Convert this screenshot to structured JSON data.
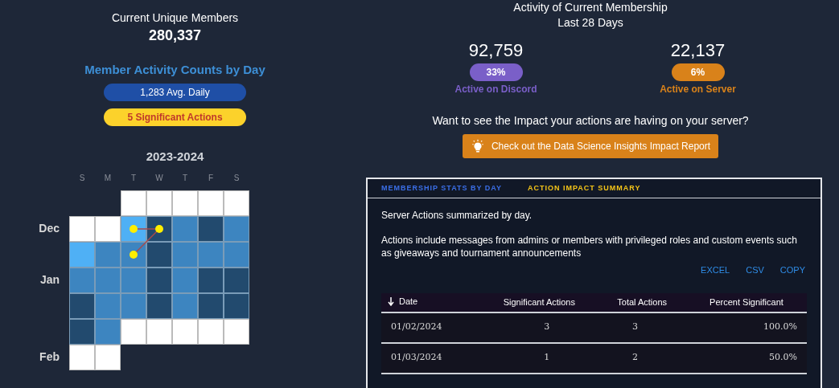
{
  "members": {
    "title": "Current Unique Members",
    "value": "280,337"
  },
  "activity_counts": {
    "title": "Member Activity Counts by Day",
    "badges": [
      {
        "text": "1,283 Avg. Daily",
        "kind": "info"
      },
      {
        "text": "5 Significant Actions",
        "kind": "warning"
      }
    ]
  },
  "calendar": {
    "title": "2023-2024",
    "weekdays": [
      "S",
      "M",
      "T",
      "W",
      "T",
      "F",
      "S"
    ],
    "weeks": [
      {
        "cells": [
          {
            "kind": "empty"
          },
          {
            "kind": "empty"
          },
          {
            "kind": "blank"
          },
          {
            "kind": "blank"
          },
          {
            "kind": "blank"
          },
          {
            "kind": "blank"
          },
          {
            "kind": "blank"
          }
        ]
      },
      {
        "month": "Dec",
        "cells": [
          {
            "kind": "blank"
          },
          {
            "kind": "blank"
          },
          {
            "kind": "low",
            "significant": true
          },
          {
            "kind": "high",
            "significant": true
          },
          {
            "kind": "mid"
          },
          {
            "kind": "high"
          },
          {
            "kind": "mid"
          }
        ]
      },
      {
        "cells": [
          {
            "kind": "low"
          },
          {
            "kind": "mid"
          },
          {
            "kind": "mid",
            "significant": true
          },
          {
            "kind": "high"
          },
          {
            "kind": "mid"
          },
          {
            "kind": "mid"
          },
          {
            "kind": "mid"
          }
        ]
      },
      {
        "month": "Jan",
        "cells": [
          {
            "kind": "mid"
          },
          {
            "kind": "mid"
          },
          {
            "kind": "mid"
          },
          {
            "kind": "high"
          },
          {
            "kind": "mid"
          },
          {
            "kind": "high"
          },
          {
            "kind": "high"
          }
        ]
      },
      {
        "cells": [
          {
            "kind": "high"
          },
          {
            "kind": "mid"
          },
          {
            "kind": "mid"
          },
          {
            "kind": "high"
          },
          {
            "kind": "mid"
          },
          {
            "kind": "high"
          },
          {
            "kind": "high"
          }
        ]
      },
      {
        "cells": [
          {
            "kind": "high"
          },
          {
            "kind": "mid"
          },
          {
            "kind": "blank"
          },
          {
            "kind": "blank"
          },
          {
            "kind": "blank"
          },
          {
            "kind": "blank"
          },
          {
            "kind": "blank"
          }
        ]
      },
      {
        "month": "Feb",
        "cells": [
          {
            "kind": "blank"
          },
          {
            "kind": "blank"
          },
          {
            "kind": "empty"
          },
          {
            "kind": "empty"
          },
          {
            "kind": "empty"
          },
          {
            "kind": "empty"
          },
          {
            "kind": "empty"
          }
        ]
      }
    ]
  },
  "membership_activity": {
    "title": "Activity of Current Membership",
    "subtitle": "Last 28 Days",
    "stats": [
      {
        "value": "92,759",
        "percent": "33%",
        "label": "Active on Discord",
        "color": "#7a5fc8"
      },
      {
        "value": "22,137",
        "percent": "6%",
        "label": "Active on Server",
        "color": "#d9821a"
      }
    ]
  },
  "impact_prompt": "Want to see the Impact your actions are having on your server?",
  "impact_button": "Check out the Data Science Insights Impact Report",
  "panel": {
    "tabs": [
      {
        "label": "MEMBERSHIP STATS BY DAY",
        "selected": false
      },
      {
        "label": "ACTION IMPACT SUMMARY",
        "selected": true
      }
    ],
    "intro": "Server Actions summarized by day.",
    "description": "Actions include messages from admins or members with privileged roles and custom events such as giveaways and tournament announcements",
    "exports": [
      "EXCEL",
      "CSV",
      "COPY"
    ],
    "table": {
      "columns": [
        {
          "label": "Date",
          "sorted": true
        },
        {
          "label": "Significant Actions",
          "sorted": false
        },
        {
          "label": "Total Actions",
          "sorted": false
        },
        {
          "label": "Percent Significant",
          "sorted": false
        }
      ],
      "rows": [
        [
          "01/02/2024",
          "3",
          "3",
          "100.0%"
        ],
        [
          "01/03/2024",
          "1",
          "2",
          "50.0%"
        ]
      ]
    }
  }
}
